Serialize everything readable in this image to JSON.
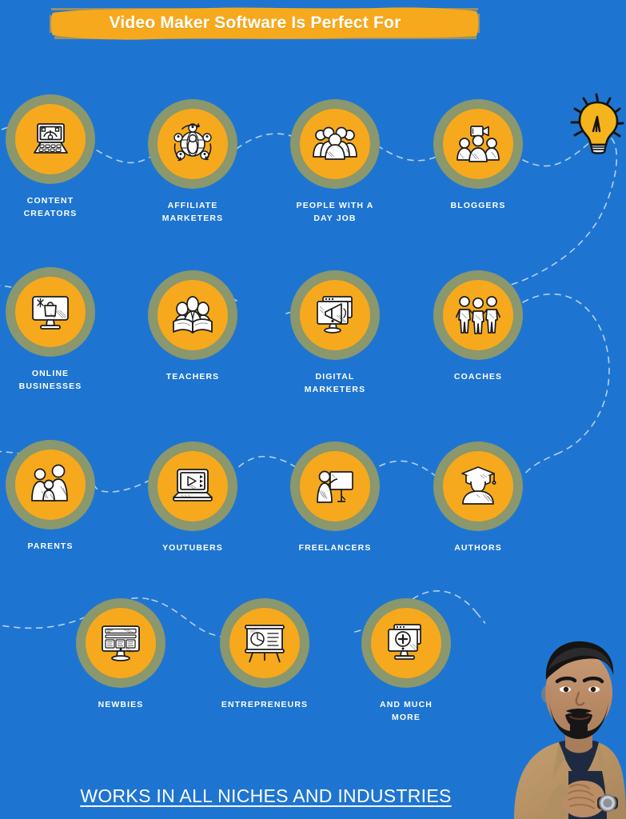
{
  "page": {
    "background_color": "#1e75d1",
    "accent_yellow": "#f6a91c",
    "ring_olive": "#8b976d",
    "text_color": "#ffffff"
  },
  "header": {
    "title": "Video Maker Software Is Perfect For",
    "banner_color": "#f6a91c"
  },
  "decor": {
    "lightbulb_label": "lightbulb",
    "presenter_label": "presenter-photo"
  },
  "nodes": [
    {
      "id": "content-creators",
      "label": "CONTENT\nCREATORS",
      "icon": "laptop-design-icon",
      "row": 1,
      "col": 1
    },
    {
      "id": "affiliate-marketers",
      "label": "AFFILIATE\nMARKETERS",
      "icon": "global-network-people-icon",
      "row": 1,
      "col": 2
    },
    {
      "id": "people-with-day-job",
      "label": "PEOPLE WITH A\nDAY JOB",
      "icon": "crowd-people-icon",
      "row": 1,
      "col": 3
    },
    {
      "id": "bloggers",
      "label": "BLOGGERS",
      "icon": "video-camera-people-icon",
      "row": 1,
      "col": 4
    },
    {
      "id": "online-businesses",
      "label": "ONLINE\nBUSINESSES",
      "icon": "monitor-shopping-bag-icon",
      "row": 2,
      "col": 1
    },
    {
      "id": "teachers",
      "label": "TEACHERS",
      "icon": "students-book-icon",
      "row": 2,
      "col": 2
    },
    {
      "id": "digital-marketers",
      "label": "DIGITAL\nMARKETERS",
      "icon": "monitor-megaphone-icon",
      "row": 2,
      "col": 3
    },
    {
      "id": "coaches",
      "label": "COACHES",
      "icon": "three-people-team-icon",
      "row": 2,
      "col": 4
    },
    {
      "id": "parents",
      "label": "PARENTS",
      "icon": "family-icon",
      "row": 3,
      "col": 1
    },
    {
      "id": "youtubers",
      "label": "YOUTUBERS",
      "icon": "laptop-play-video-icon",
      "row": 3,
      "col": 2
    },
    {
      "id": "freelancers",
      "label": "FREELANCERS",
      "icon": "person-whiteboard-icon",
      "row": 3,
      "col": 3
    },
    {
      "id": "authors",
      "label": "AUTHORS",
      "icon": "graduate-person-icon",
      "row": 3,
      "col": 4
    },
    {
      "id": "newbies",
      "label": "NEWBIES",
      "icon": "monitor-webpage-icon",
      "row": 4,
      "col": 2
    },
    {
      "id": "entrepreneurs",
      "label": "ENTREPRENEURS",
      "icon": "presentation-chart-icon",
      "row": 4,
      "col": 3
    },
    {
      "id": "and-much-more",
      "label": "AND MUCH\nMORE",
      "icon": "monitor-plus-icon",
      "row": 4,
      "col": 4
    }
  ],
  "footer": {
    "text": "WORKS IN ALL NICHES AND INDUSTRIES"
  }
}
